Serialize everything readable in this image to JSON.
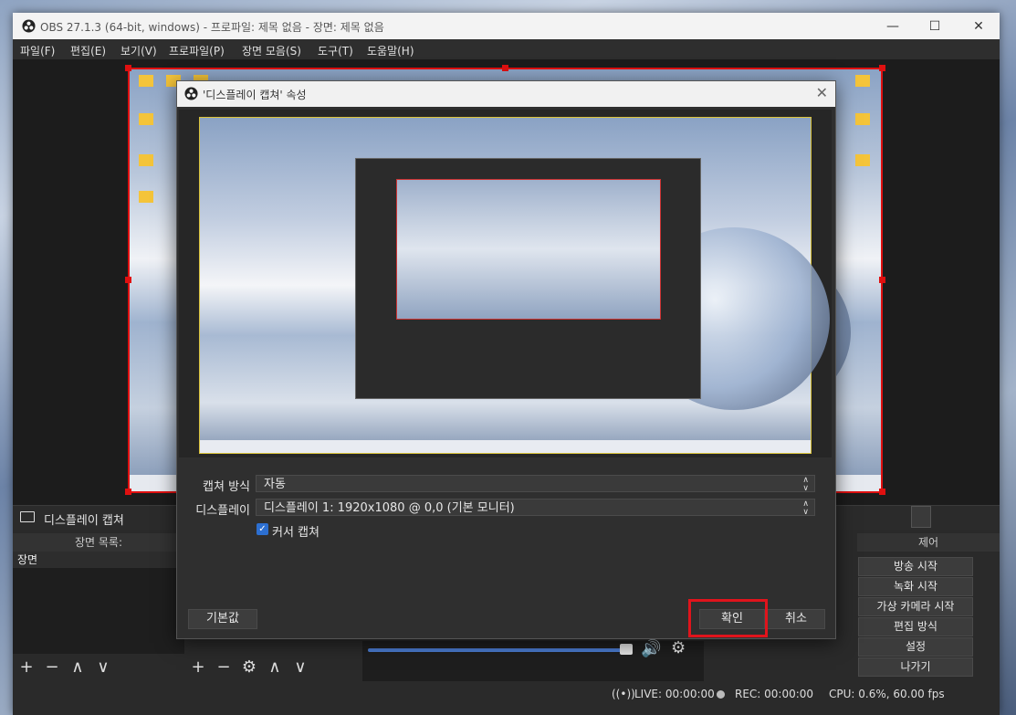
{
  "window": {
    "title": "OBS 27.1.3 (64-bit, windows) - 프로파일: 제목 없음 - 장면: 제목 없음",
    "minimize": "—",
    "maximize": "☐",
    "close": "✕"
  },
  "menu": [
    "파일(F)",
    "편집(E)",
    "보기(V)",
    "프로파일(P)",
    "장면 모음(S)",
    "도구(T)",
    "도움말(H)"
  ],
  "source_bar": {
    "label": "디스플레이 캡쳐"
  },
  "docks": {
    "scenes_title": "장면 목록:",
    "scenes": [
      "장면"
    ],
    "controls_title": "제어"
  },
  "controls": [
    "방송 시작",
    "녹화 시작",
    "가상 카메라 시작",
    "편집 방식",
    "설정",
    "나가기"
  ],
  "statusbar": {
    "live": "LIVE: 00:00:00",
    "rec": "REC: 00:00:00",
    "cpu": "CPU: 0.6%, 60.00 fps"
  },
  "dialog": {
    "title": "'디스플레이 캡쳐' 속성",
    "close": "✕",
    "capture_method_label": "캡쳐 방식",
    "capture_method_value": "자동",
    "display_label": "디스플레이",
    "display_value": "디스플레이 1: 1920x1080 @ 0,0 (기본 모니터)",
    "cursor_checkbox_label": "커서 캡쳐",
    "cursor_checked": true,
    "defaults_button": "기본값",
    "ok_button": "확인",
    "cancel_button": "취소"
  },
  "colors": {
    "accent": "#2c6fd1",
    "highlight": "#e0141c",
    "panel": "#2a2a2a"
  }
}
